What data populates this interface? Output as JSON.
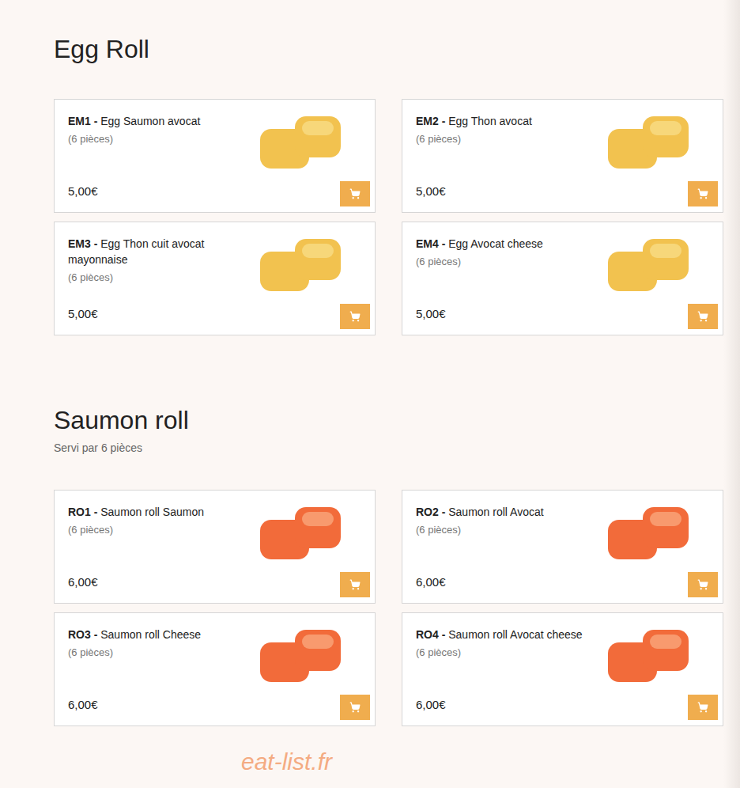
{
  "sections": [
    {
      "title": "Egg Roll",
      "kind": "egg",
      "items": [
        {
          "code": "EM1 -",
          "name": "Egg Saumon avocat",
          "pieces": "(6 pièces)",
          "price": "5,00€"
        },
        {
          "code": "EM2 -",
          "name": "Egg Thon avocat",
          "pieces": "(6 pièces)",
          "price": "5,00€"
        },
        {
          "code": "EM3 -",
          "name": "Egg Thon cuit avocat mayonnaise",
          "pieces": "(6 pièces)",
          "price": "5,00€"
        },
        {
          "code": "EM4 -",
          "name": "Egg Avocat cheese",
          "pieces": "(6 pièces)",
          "price": "5,00€"
        }
      ]
    },
    {
      "title": "Saumon roll",
      "subtitle": "Servi par 6 pièces",
      "kind": "salmon",
      "items": [
        {
          "code": "RO1 -",
          "name": "Saumon roll Saumon",
          "pieces": "(6 pièces)",
          "price": "6,00€"
        },
        {
          "code": "RO2 -",
          "name": "Saumon roll Avocat",
          "pieces": "(6 pièces)",
          "price": "6,00€"
        },
        {
          "code": "RO3 -",
          "name": "Saumon roll Cheese",
          "pieces": "(6 pièces)",
          "price": "6,00€"
        },
        {
          "code": "RO4 -",
          "name": "Saumon roll Avocat cheese",
          "pieces": "(6 pièces)",
          "price": "6,00€"
        }
      ]
    }
  ],
  "watermark": "eat-list.fr"
}
